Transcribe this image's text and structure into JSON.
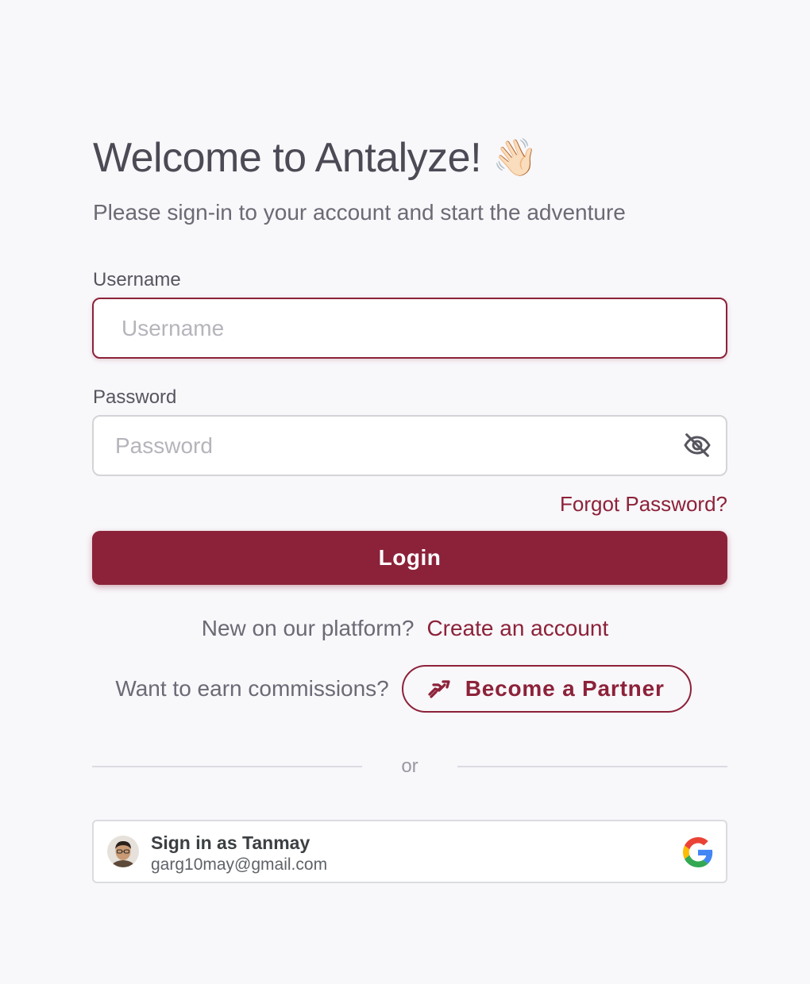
{
  "header": {
    "title": "Welcome to Antalyze!",
    "title_emoji": "👋🏻",
    "subtitle": "Please sign-in to your account and start the adventure"
  },
  "form": {
    "username": {
      "label": "Username",
      "placeholder": "Username",
      "value": ""
    },
    "password": {
      "label": "Password",
      "placeholder": "Password",
      "value": "",
      "toggle_icon": "eye-off-icon"
    },
    "forgot_link": "Forgot Password?",
    "login_label": "Login"
  },
  "signup": {
    "prompt": "New on our platform?",
    "link": "Create an account"
  },
  "partner": {
    "prompt": "Want to earn commissions?",
    "button_label": "Become a Partner",
    "button_icon": "handshake-icon"
  },
  "divider": {
    "label": "or"
  },
  "google_account": {
    "name_line": "Sign in as Tanmay",
    "email": "garg10may@gmail.com",
    "logo_icon": "google-g-icon"
  },
  "colors": {
    "brand": "#8c2239",
    "background": "#f8f7fa",
    "text": "#4b4a55",
    "muted_text": "#6b6a75"
  }
}
